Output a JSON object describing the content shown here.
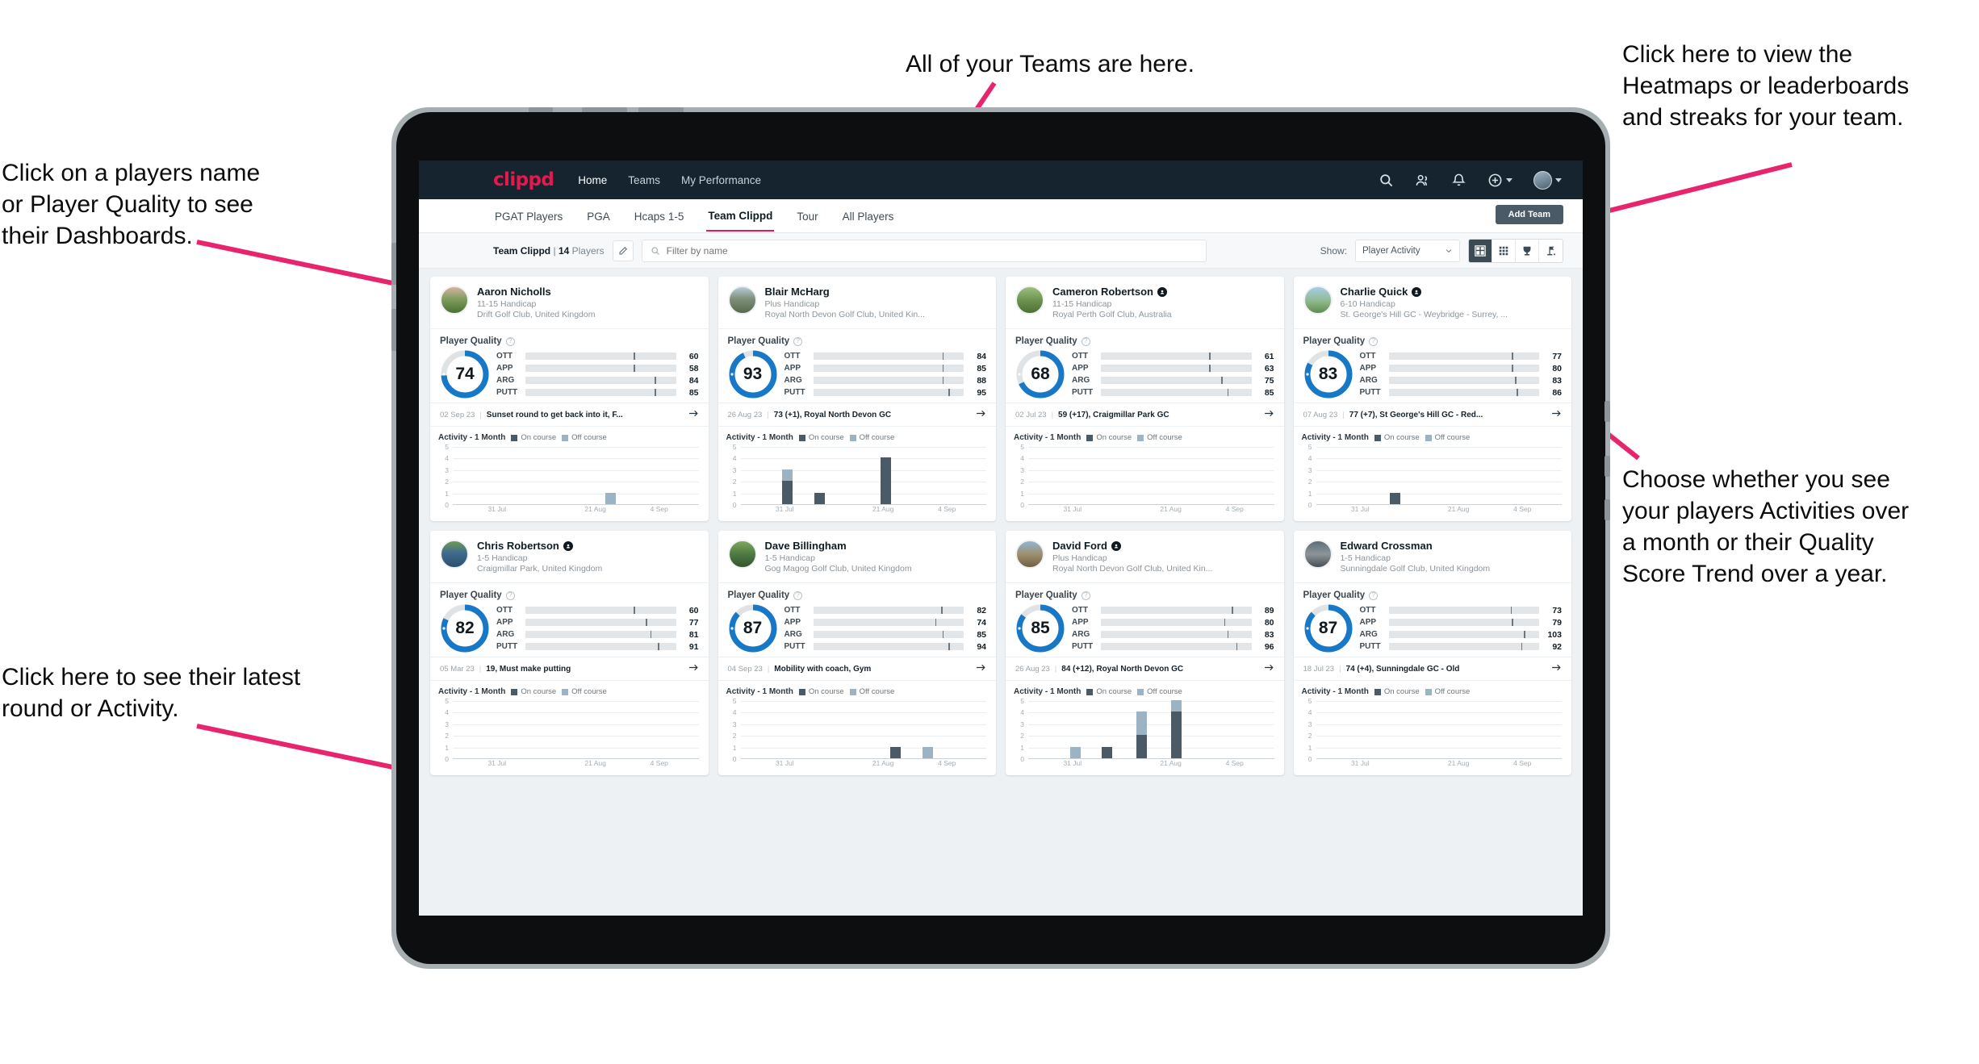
{
  "annotations": {
    "teams": "All of your Teams are here.",
    "heatmaps": "Click here to view the\nHeatmaps or leaderboards\nand streaks for your team.",
    "player_names": "Click on a players name\nor Player Quality to see\ntheir Dashboards.",
    "choose": "Choose whether you see\nyour players Activities over\na month or their Quality\nScore Trend over a year.",
    "latest_round": "Click here to see their latest\nround or Activity."
  },
  "navbar": {
    "logo": "clippd",
    "links": [
      {
        "label": "Home",
        "active": true
      },
      {
        "label": "Teams",
        "active": false
      },
      {
        "label": "My Performance",
        "active": false
      }
    ],
    "icons": [
      "search-icon",
      "people-icon",
      "bell-icon",
      "plus-circle-icon",
      "avatar"
    ]
  },
  "subtabs": {
    "items": [
      {
        "label": "PGAT Players",
        "active": false
      },
      {
        "label": "PGA",
        "active": false
      },
      {
        "label": "Hcaps 1-5",
        "active": false
      },
      {
        "label": "Team Clippd",
        "active": true
      },
      {
        "label": "Tour",
        "active": false
      },
      {
        "label": "All Players",
        "active": false
      }
    ],
    "add_team_label": "Add Team"
  },
  "toolbar": {
    "team_name": "Team Clippd",
    "separator": "|",
    "player_count": "14",
    "players_word": "Players",
    "edit_icon": "pencil-icon",
    "search_placeholder": "Filter by name",
    "search_value": "",
    "show_label": "Show:",
    "show_value": "Player Activity",
    "show_options": [
      "Player Activity",
      "Quality Score Trend"
    ],
    "views": [
      {
        "name": "cards-view",
        "icon": "grid-large-icon",
        "active": true
      },
      {
        "name": "table-view",
        "icon": "grid-small-icon",
        "active": false
      },
      {
        "name": "leaderboard-view",
        "icon": "trophy-icon",
        "active": false
      },
      {
        "name": "heatmap-view",
        "icon": "flag-icon",
        "active": false
      }
    ]
  },
  "card_labels": {
    "player_quality": "Player Quality",
    "help_icon": "question-icon",
    "activity_title": "Activity - 1 Month",
    "legend_on": "On course",
    "legend_off": "Off course",
    "arrow_icon": "arrow-right-icon",
    "verified_icon": "verified-badge-icon"
  },
  "metric_colors": {
    "OTT": "#f5a623",
    "APP": "#3edcad",
    "ARG": "#f5196b",
    "PUTT": "#a615cf",
    "donut": "#1878c8",
    "donut_track": "#dfe3e6",
    "on_course": "#4a5a66",
    "off_course": "#9cb3c4",
    "accent": "#e8174e"
  },
  "chart_data": {
    "type": "bar",
    "title": "Activity - 1 Month",
    "ylabel": "",
    "xlabel": "",
    "ylim": [
      0,
      5
    ],
    "yticks": [
      0,
      1,
      2,
      3,
      4,
      5
    ],
    "xticks": [
      "31 Jul",
      "21 Aug",
      "4 Sep"
    ],
    "legend": [
      "On course",
      "Off course"
    ],
    "legend_position": "top",
    "grid": true,
    "stacked": true
  },
  "players": [
    {
      "name": "Aaron Nicholls",
      "verified": false,
      "handicap": "11-15 Handicap",
      "club": "Drift Golf Club, United Kingdom",
      "quality": 74,
      "metrics": [
        {
          "label": "OTT",
          "value": 60,
          "fill": 55,
          "tick": 72
        },
        {
          "label": "APP",
          "value": 58,
          "fill": 55,
          "tick": 72
        },
        {
          "label": "ARG",
          "value": 84,
          "fill": 78,
          "tick": 86
        },
        {
          "label": "PUTT",
          "value": 85,
          "fill": 78,
          "tick": 86
        }
      ],
      "round": {
        "date": "02 Sep 23",
        "text": "Sunset round to get back into it, F..."
      },
      "activity": [
        {
          "x": 62,
          "on": 0,
          "off": 1
        }
      ]
    },
    {
      "name": "Blair McHarg",
      "verified": false,
      "handicap": "Plus Handicap",
      "club": "Royal North Devon Golf Club, United Kin...",
      "quality": 93,
      "metrics": [
        {
          "label": "OTT",
          "value": 84,
          "fill": 79,
          "tick": 86
        },
        {
          "label": "APP",
          "value": 85,
          "fill": 79,
          "tick": 86
        },
        {
          "label": "ARG",
          "value": 88,
          "fill": 79,
          "tick": 86
        },
        {
          "label": "PUTT",
          "value": 95,
          "fill": 85,
          "tick": 90
        }
      ],
      "round": {
        "date": "26 Aug 23",
        "text": "73 (+1), Royal North Devon GC"
      },
      "activity": [
        {
          "x": 17,
          "on": 2,
          "off": 1
        },
        {
          "x": 30,
          "on": 1,
          "off": 0
        },
        {
          "x": 57,
          "on": 4,
          "off": 0
        }
      ]
    },
    {
      "name": "Cameron Robertson",
      "verified": true,
      "handicap": "11-15 Handicap",
      "club": "Royal Perth Golf Club, Australia",
      "quality": 68,
      "metrics": [
        {
          "label": "OTT",
          "value": 61,
          "fill": 56,
          "tick": 72
        },
        {
          "label": "APP",
          "value": 63,
          "fill": 56,
          "tick": 72
        },
        {
          "label": "ARG",
          "value": 75,
          "fill": 68,
          "tick": 80
        },
        {
          "label": "PUTT",
          "value": 85,
          "fill": 76,
          "tick": 84
        }
      ],
      "round": {
        "date": "02 Jul 23",
        "text": "59 (+17), Craigmillar Park GC"
      },
      "activity": []
    },
    {
      "name": "Charlie Quick",
      "verified": true,
      "handicap": "6-10 Handicap",
      "club": "St. George's Hill GC - Weybridge - Surrey, ...",
      "quality": 83,
      "metrics": [
        {
          "label": "OTT",
          "value": 77,
          "fill": 72,
          "tick": 82
        },
        {
          "label": "APP",
          "value": 80,
          "fill": 72,
          "tick": 82
        },
        {
          "label": "ARG",
          "value": 83,
          "fill": 76,
          "tick": 84
        },
        {
          "label": "PUTT",
          "value": 86,
          "fill": 78,
          "tick": 85
        }
      ],
      "round": {
        "date": "07 Aug 23",
        "text": "77 (+7), St George's Hill GC - Red..."
      },
      "activity": [
        {
          "x": 30,
          "on": 1,
          "off": 0
        }
      ]
    },
    {
      "name": "Chris Robertson",
      "verified": true,
      "handicap": "1-5 Handicap",
      "club": "Craigmillar Park, United Kingdom",
      "quality": 82,
      "metrics": [
        {
          "label": "OTT",
          "value": 60,
          "fill": 56,
          "tick": 72
        },
        {
          "label": "APP",
          "value": 77,
          "fill": 70,
          "tick": 80
        },
        {
          "label": "ARG",
          "value": 81,
          "fill": 74,
          "tick": 83
        },
        {
          "label": "PUTT",
          "value": 91,
          "fill": 82,
          "tick": 88
        }
      ],
      "round": {
        "date": "05 Mar 23",
        "text": "19, Must make putting"
      },
      "activity": []
    },
    {
      "name": "Dave Billingham",
      "verified": false,
      "handicap": "1-5 Handicap",
      "club": "Gog Magog Golf Club, United Kingdom",
      "quality": 87,
      "metrics": [
        {
          "label": "OTT",
          "value": 82,
          "fill": 76,
          "tick": 85
        },
        {
          "label": "APP",
          "value": 74,
          "fill": 70,
          "tick": 81
        },
        {
          "label": "ARG",
          "value": 85,
          "fill": 78,
          "tick": 86
        },
        {
          "label": "PUTT",
          "value": 94,
          "fill": 85,
          "tick": 90
        }
      ],
      "round": {
        "date": "04 Sep 23",
        "text": "Mobility with coach, Gym"
      },
      "activity": [
        {
          "x": 61,
          "on": 1,
          "off": 0
        },
        {
          "x": 74,
          "on": 0,
          "off": 1
        }
      ]
    },
    {
      "name": "David Ford",
      "verified": true,
      "handicap": "Plus Handicap",
      "club": "Royal North Devon Golf Club, United Kin...",
      "quality": 85,
      "metrics": [
        {
          "label": "OTT",
          "value": 89,
          "fill": 80,
          "tick": 87
        },
        {
          "label": "APP",
          "value": 80,
          "fill": 73,
          "tick": 82
        },
        {
          "label": "ARG",
          "value": 83,
          "fill": 76,
          "tick": 84
        },
        {
          "label": "PUTT",
          "value": 96,
          "fill": 85,
          "tick": 90
        }
      ],
      "round": {
        "date": "26 Aug 23",
        "text": "84 (+12), Royal North Devon GC"
      },
      "activity": [
        {
          "x": 17,
          "on": 0,
          "off": 1
        },
        {
          "x": 30,
          "on": 1,
          "off": 0
        },
        {
          "x": 44,
          "on": 2,
          "off": 2
        },
        {
          "x": 58,
          "on": 4,
          "off": 1
        }
      ]
    },
    {
      "name": "Edward Crossman",
      "verified": false,
      "handicap": "1-5 Handicap",
      "club": "Sunningdale Golf Club, United Kingdom",
      "quality": 87,
      "metrics": [
        {
          "label": "OTT",
          "value": 73,
          "fill": 70,
          "tick": 81
        },
        {
          "label": "APP",
          "value": 79,
          "fill": 73,
          "tick": 82
        },
        {
          "label": "ARG",
          "value": 103,
          "fill": 85,
          "tick": 90
        },
        {
          "label": "PUTT",
          "value": 92,
          "fill": 82,
          "tick": 88
        }
      ],
      "round": {
        "date": "18 Jul 23",
        "text": "74 (+4), Sunningdale GC - Old"
      },
      "activity": []
    }
  ]
}
